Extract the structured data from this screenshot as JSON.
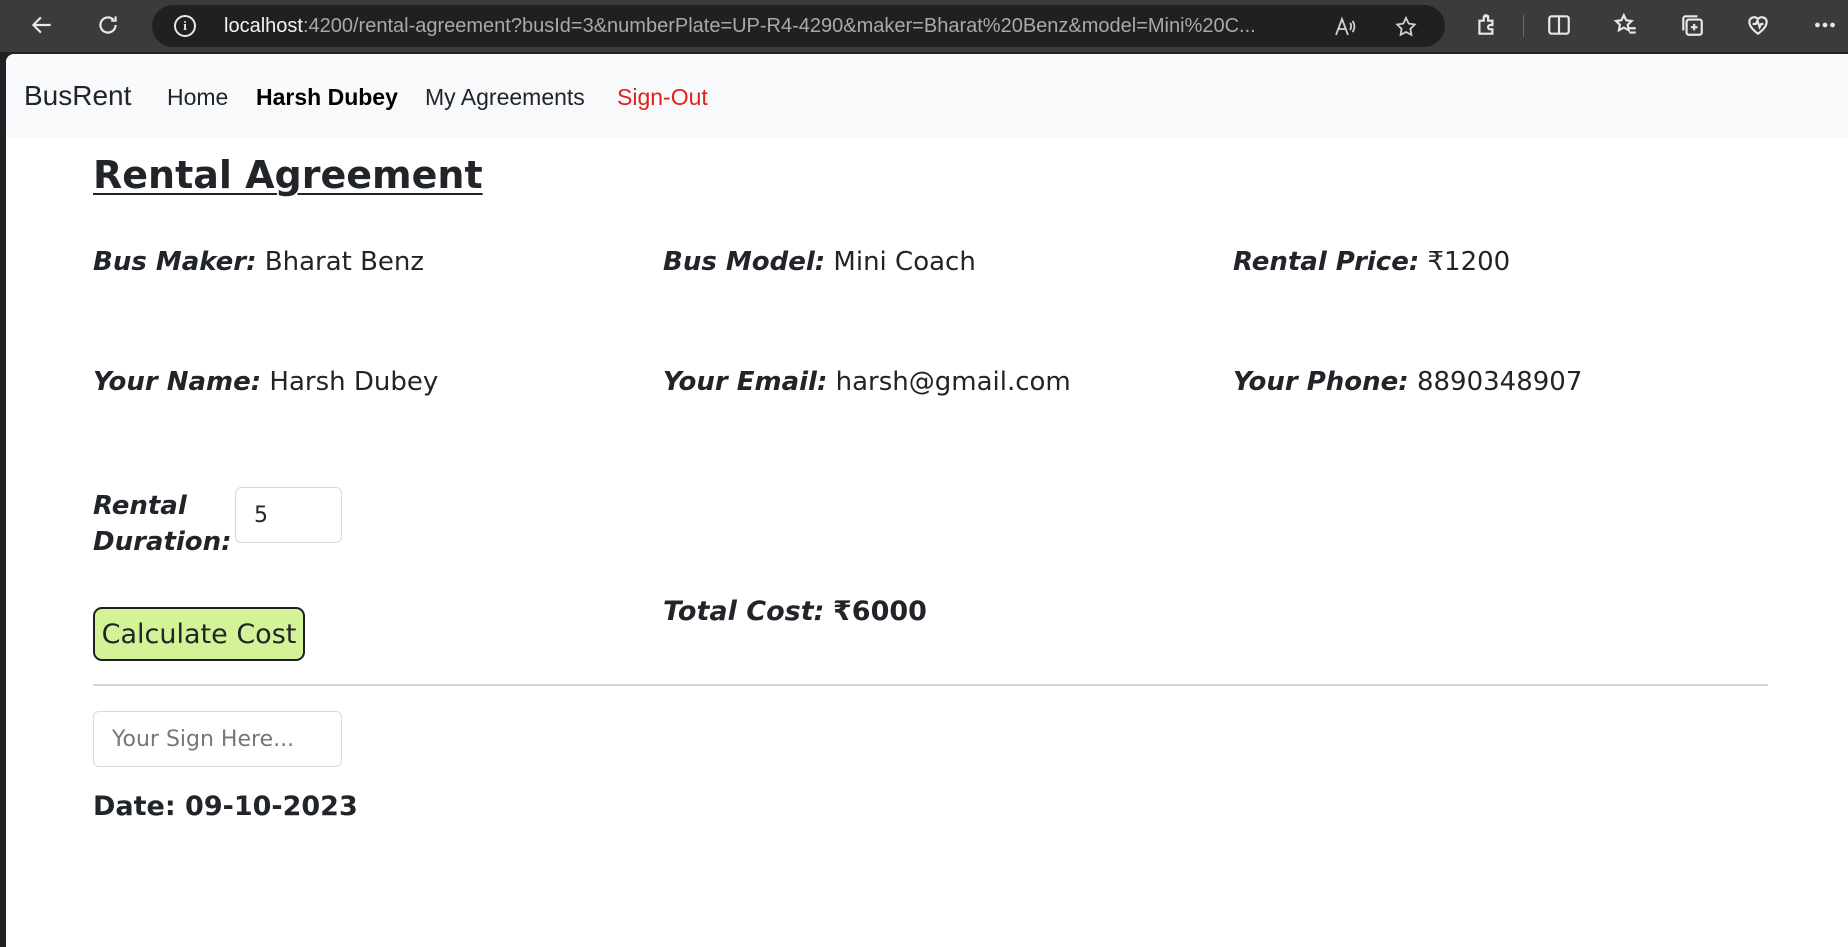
{
  "browser": {
    "url_host": "localhost",
    "url_rest": ":4200/rental-agreement?busId=3&numberPlate=UP-R4-4290&maker=Bharat%20Benz&model=Mini%20C...",
    "icons": [
      "back-arrow-icon",
      "refresh-icon",
      "info-icon",
      "read-aloud-icon",
      "favorite-star-icon",
      "extensions-icon",
      "split-screen-icon",
      "favorites-icon",
      "collections-icon",
      "browser-essentials-icon",
      "more-icon"
    ]
  },
  "navbar": {
    "brand": "BusRent",
    "links": [
      {
        "label": "Home"
      },
      {
        "label": "Harsh Dubey"
      },
      {
        "label": "My Agreements"
      },
      {
        "label": "Sign-Out"
      }
    ]
  },
  "agreement": {
    "title": "Rental Agreement",
    "bus_maker_label": "Bus Maker:",
    "bus_maker": "Bharat Benz",
    "bus_model_label": "Bus Model:",
    "bus_model": "Mini Coach",
    "rental_price_label": "Rental Price:",
    "rental_price": "₹1200",
    "name_label": "Your Name:",
    "name": "Harsh Dubey",
    "email_label": "Your Email:",
    "email": "harsh@gmail.com",
    "phone_label": "Your Phone:",
    "phone": "8890348907",
    "duration_label": "Rental Duration:",
    "duration_value": "5",
    "calculate_button": "Calculate Cost",
    "total_label": "Total Cost:",
    "total_value": "₹6000",
    "sign_placeholder": "Your Sign Here...",
    "date_text": "Date: 09-10-2023"
  },
  "colors": {
    "button_bg": "#d4f396",
    "signout": "#e0201a",
    "navbar_bg": "#f8f9fa"
  }
}
